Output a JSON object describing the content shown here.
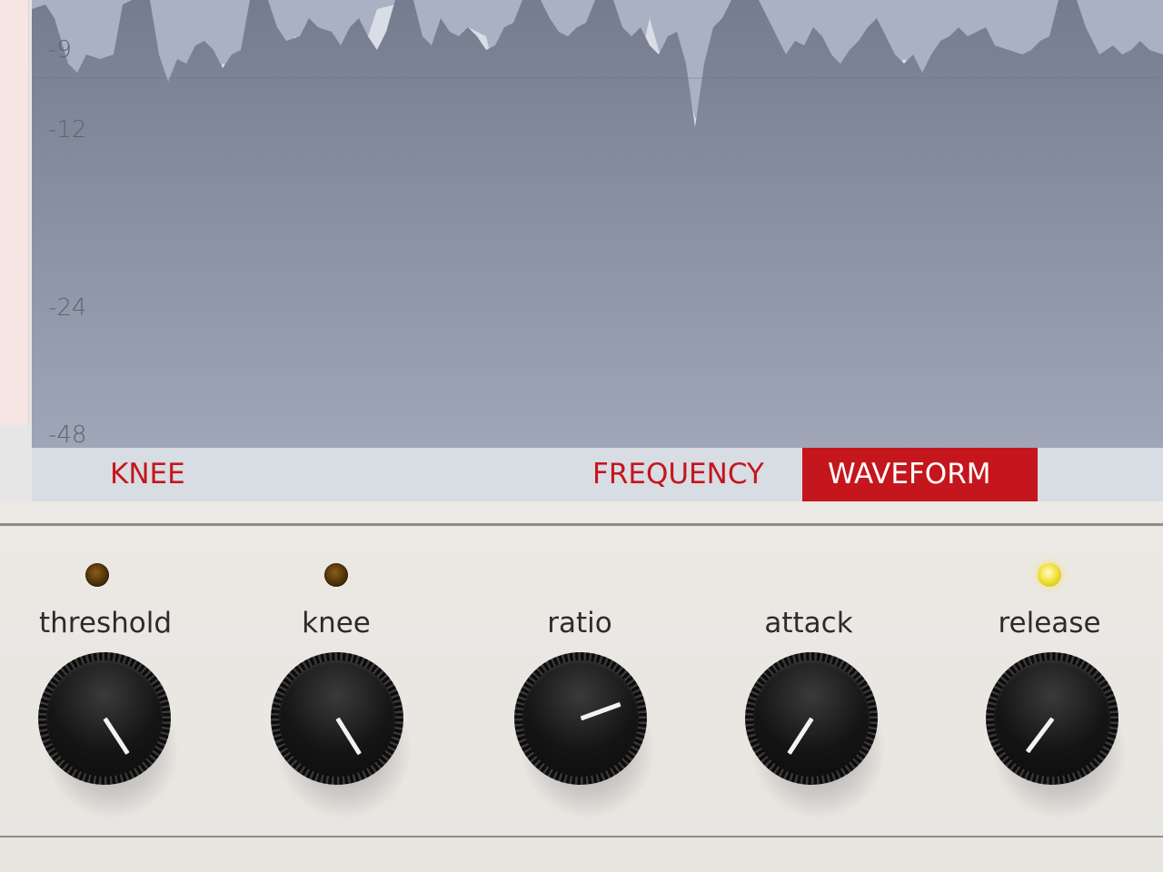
{
  "display": {
    "db_labels": [
      "-9",
      "-12",
      "-24",
      "-48"
    ],
    "colors": {
      "background": "#d9dde5",
      "peak": "#a6aec0",
      "body": "#7a8294"
    }
  },
  "tabs": {
    "knee": "KNEE",
    "frequency": "FREQUENCY",
    "waveform": "WAVEFORM",
    "active": "WAVEFORM",
    "accent": "#c4161c"
  },
  "controls": [
    {
      "label": "threshold",
      "led": "off",
      "pointer_angle": -33
    },
    {
      "label": "knee",
      "led": "off",
      "pointer_angle": -32
    },
    {
      "label": "ratio",
      "led": "off_hidden",
      "pointer_angle": -110
    },
    {
      "label": "attack",
      "led": "off_hidden",
      "pointer_angle": 33
    },
    {
      "label": "release",
      "led": "on",
      "pointer_angle": 37
    }
  ]
}
